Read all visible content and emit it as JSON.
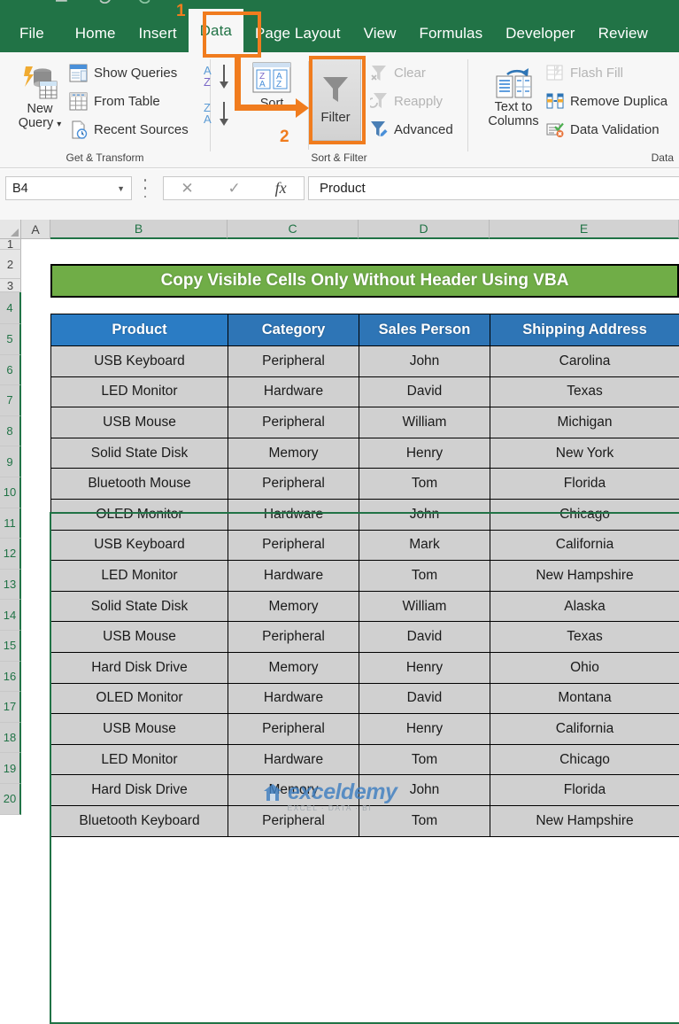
{
  "app": {
    "quick_access_icons": [
      "save-icon",
      "undo-icon",
      "redo-icon"
    ]
  },
  "ribbon": {
    "tabs": [
      {
        "label": "File",
        "active": false
      },
      {
        "label": "Home",
        "active": false
      },
      {
        "label": "Insert",
        "active": false
      },
      {
        "label": "Data",
        "active": true
      },
      {
        "label": "Page Layout",
        "active": false
      },
      {
        "label": "View",
        "active": false
      },
      {
        "label": "Formulas",
        "active": false
      },
      {
        "label": "Developer",
        "active": false
      },
      {
        "label": "Review",
        "active": false
      }
    ],
    "groups": [
      {
        "name": "Get & Transform",
        "label": "Get & Transform",
        "big_button": {
          "line1": "New",
          "line2": "Query",
          "icon": "new-query-icon",
          "has_dropdown": true
        },
        "items": [
          {
            "label": "Show Queries",
            "icon": "show-queries-icon",
            "disabled": false
          },
          {
            "label": "From Table",
            "icon": "from-table-icon",
            "disabled": false
          },
          {
            "label": "Recent Sources",
            "icon": "recent-sources-icon",
            "disabled": false
          }
        ]
      },
      {
        "name": "Sort & Filter",
        "label": "Sort & Filter",
        "sort_asc_label": "A-Z sort ascending",
        "sort_desc_label": "Z-A sort descending",
        "sort_label": "Sort",
        "filter_label": "Filter",
        "items": [
          {
            "label": "Clear",
            "icon": "clear-filter-icon",
            "disabled": true
          },
          {
            "label": "Reapply",
            "icon": "reapply-icon",
            "disabled": true
          },
          {
            "label": "Advanced",
            "icon": "advanced-filter-icon",
            "disabled": false
          }
        ]
      },
      {
        "name": "Data Tools",
        "label": "Data",
        "big_button": {
          "line1": "Text to",
          "line2": "Columns",
          "icon": "text-to-columns-icon",
          "has_dropdown": false
        },
        "items": [
          {
            "label": "Flash Fill",
            "icon": "flash-fill-icon",
            "disabled": true
          },
          {
            "label": "Remove Duplica",
            "icon": "remove-duplicates-icon",
            "disabled": false
          },
          {
            "label": "Data Validation",
            "icon": "data-validation-icon",
            "disabled": false
          }
        ]
      }
    ]
  },
  "annotations": [
    {
      "step": "1",
      "target": "Data tab",
      "color": "#f07c1e"
    },
    {
      "step": "2",
      "target": "Filter button",
      "color": "#f07c1e"
    }
  ],
  "formula_bar": {
    "name_box_value": "B4",
    "cancel_icon": "cancel-icon",
    "enter_icon": "check-icon",
    "function_icon": "fx-icon",
    "formula_value": "Product"
  },
  "grid": {
    "column_headers": [
      "A",
      "B",
      "C",
      "D",
      "E"
    ],
    "selected_columns": [
      "B",
      "C",
      "D",
      "E"
    ],
    "row_headers": [
      "1",
      "2",
      "3",
      "4",
      "5",
      "6",
      "7",
      "8",
      "9",
      "10",
      "11",
      "12",
      "13",
      "14",
      "15",
      "16",
      "17",
      "18",
      "19",
      "20"
    ],
    "selected_rows": [
      "4",
      "5",
      "6",
      "7",
      "8",
      "9",
      "10",
      "11",
      "12",
      "13",
      "14",
      "15",
      "16",
      "17",
      "18",
      "19",
      "20"
    ],
    "title_banner": {
      "text": "Copy Visible Cells Only Without Header Using VBA",
      "row": "2",
      "fill": "#70ad47",
      "font_color": "#ffffff"
    },
    "table": {
      "header_row": "4",
      "header_fill": "#2e75b6",
      "cell_fill": "#d0d0d0",
      "headers": [
        "Product",
        "Category",
        "Sales Person",
        "Shipping Address"
      ],
      "rows": [
        [
          "USB Keyboard",
          "Peripheral",
          "John",
          "Carolina"
        ],
        [
          "LED Monitor",
          "Hardware",
          "David",
          "Texas"
        ],
        [
          "USB Mouse",
          "Peripheral",
          "William",
          "Michigan"
        ],
        [
          "Solid State Disk",
          "Memory",
          "Henry",
          "New York"
        ],
        [
          "Bluetooth Mouse",
          "Peripheral",
          "Tom",
          "Florida"
        ],
        [
          "OLED Monitor",
          "Hardware",
          "John",
          "Chicago"
        ],
        [
          "USB Keyboard",
          "Peripheral",
          "Mark",
          "California"
        ],
        [
          "LED Monitor",
          "Hardware",
          "Tom",
          "New Hampshire"
        ],
        [
          "Solid State Disk",
          "Memory",
          "William",
          "Alaska"
        ],
        [
          "USB Mouse",
          "Peripheral",
          "David",
          "Texas"
        ],
        [
          "Hard Disk Drive",
          "Memory",
          "Henry",
          "Ohio"
        ],
        [
          "OLED Monitor",
          "Hardware",
          "David",
          "Montana"
        ],
        [
          "USB Mouse",
          "Peripheral",
          "Henry",
          "California"
        ],
        [
          "LED Monitor",
          "Hardware",
          "Tom",
          "Chicago"
        ],
        [
          "Hard Disk Drive",
          "Memory",
          "John",
          "Florida"
        ],
        [
          "Bluetooth Keyboard",
          "Peripheral",
          "Tom",
          "New Hampshire"
        ]
      ]
    }
  },
  "watermark": {
    "brand": "exceldemy",
    "tagline": "EXCEL · DATA · BI",
    "color": "#3f7fc1"
  }
}
